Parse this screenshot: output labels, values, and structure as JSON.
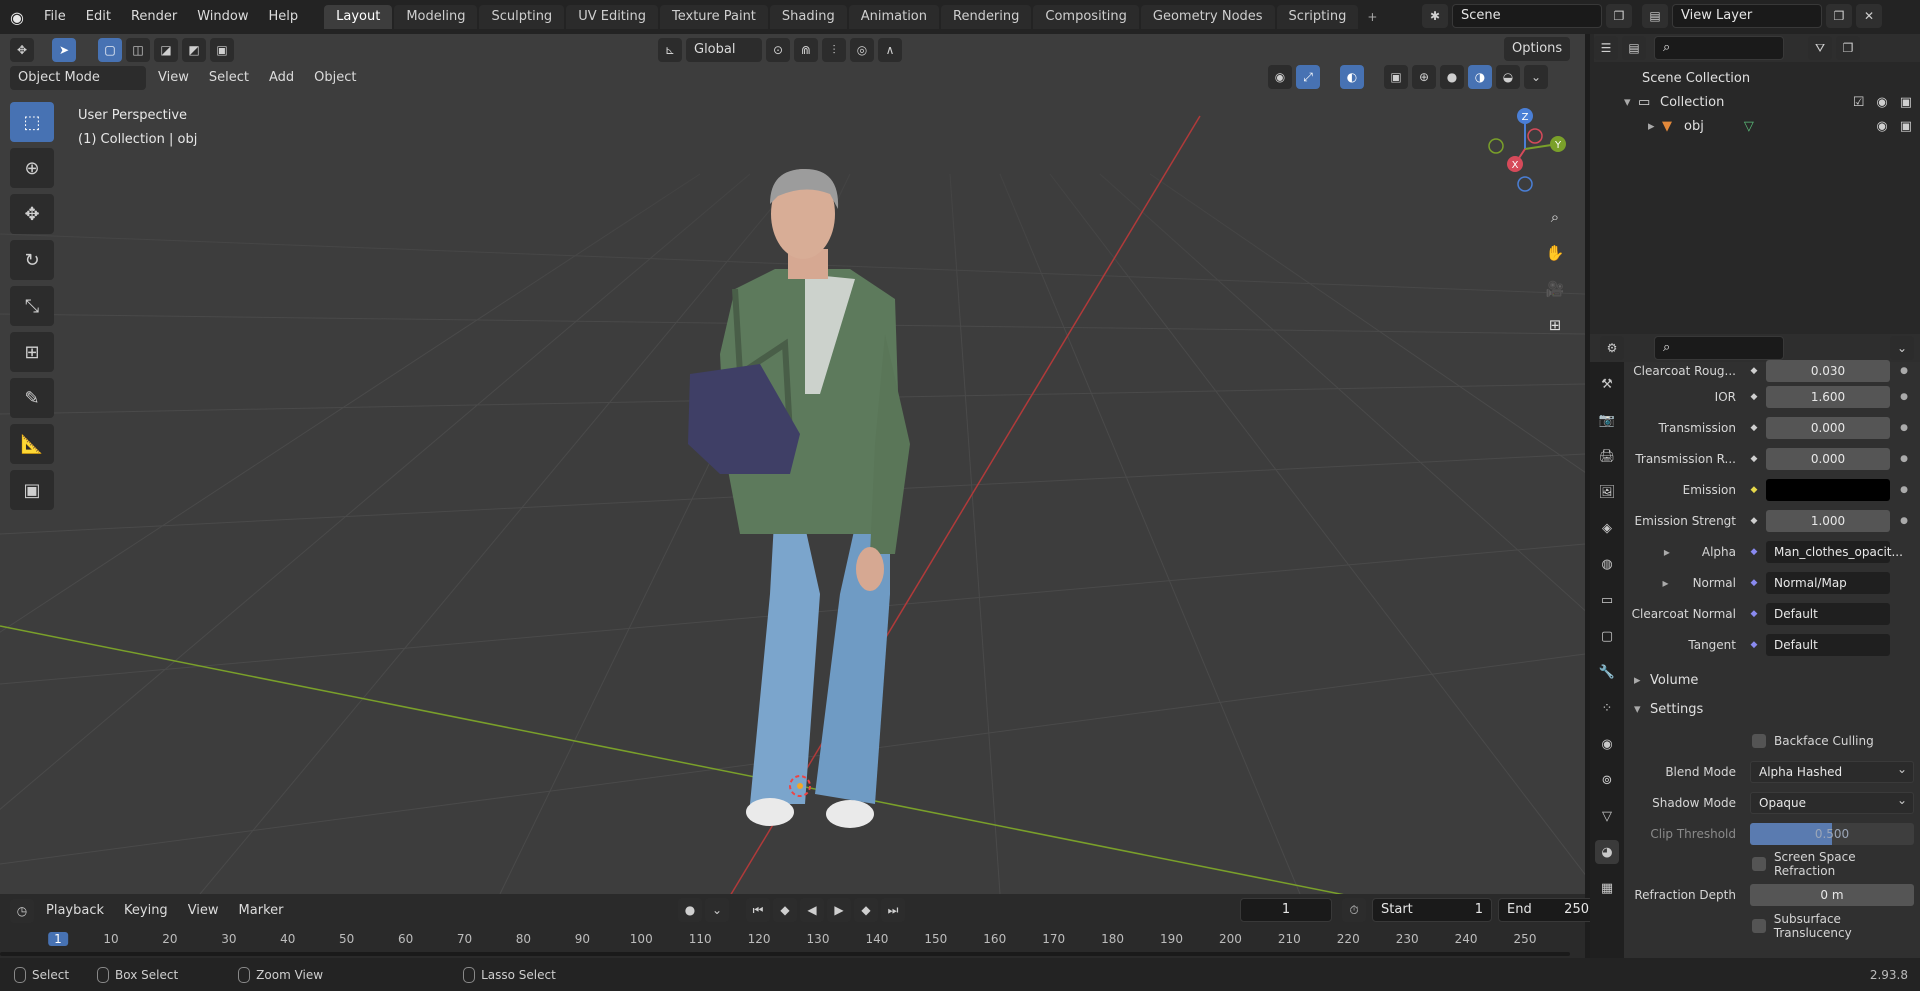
{
  "topbar": {
    "menus": [
      "File",
      "Edit",
      "Render",
      "Window",
      "Help"
    ],
    "workspaces": [
      "Layout",
      "Modeling",
      "Sculpting",
      "UV Editing",
      "Texture Paint",
      "Shading",
      "Animation",
      "Rendering",
      "Compositing",
      "Geometry Nodes",
      "Scripting"
    ],
    "active_workspace": "Layout",
    "scene": "Scene",
    "view_layer": "View Layer"
  },
  "viewport": {
    "orientation": "Global",
    "options": "Options",
    "mode": "Object Mode",
    "menus": [
      "View",
      "Select",
      "Add",
      "Object"
    ],
    "overlay_perspective": "User Perspective",
    "overlay_collection": "(1) Collection | obj",
    "gizmo": {
      "x": "X",
      "y": "Y",
      "z": "Z"
    }
  },
  "timeline": {
    "menus": [
      "Playback",
      "Keying",
      "View",
      "Marker"
    ],
    "current_frame": "1",
    "start_label": "Start",
    "start": "1",
    "end_label": "End",
    "end": "250",
    "ruler_ticks": [
      "1",
      "10",
      "20",
      "30",
      "40",
      "50",
      "60",
      "70",
      "80",
      "90",
      "100",
      "110",
      "120",
      "130",
      "140",
      "150",
      "160",
      "170",
      "180",
      "190",
      "200",
      "210",
      "220",
      "230",
      "240",
      "250"
    ]
  },
  "statusbar": {
    "select": "Select",
    "box_select": "Box Select",
    "zoom_view": "Zoom View",
    "lasso_select": "Lasso Select",
    "version": "2.93.8"
  },
  "outliner": {
    "scene_collection": "Scene Collection",
    "collection": "Collection",
    "object": "obj"
  },
  "properties": {
    "rows": [
      {
        "label": "Clearcoat Roug...",
        "value": "0.030"
      },
      {
        "label": "IOR",
        "value": "1.600"
      },
      {
        "label": "Transmission",
        "value": "0.000"
      },
      {
        "label": "Transmission R...",
        "value": "0.000"
      },
      {
        "label": "Emission",
        "value": ""
      },
      {
        "label": "Emission Strengt",
        "value": "1.000"
      },
      {
        "label": "Alpha",
        "value": "Man_clothes_opacit..."
      },
      {
        "label": "Normal",
        "value": "Normal/Map"
      },
      {
        "label": "Clearcoat Normal",
        "value": "Default"
      },
      {
        "label": "Tangent",
        "value": "Default"
      }
    ],
    "volume_section": "Volume",
    "settings_section": "Settings",
    "backface_culling": "Backface Culling",
    "blend_mode_label": "Blend Mode",
    "blend_mode": "Alpha Hashed",
    "shadow_mode_label": "Shadow Mode",
    "shadow_mode": "Opaque",
    "clip_threshold_label": "Clip Threshold",
    "clip_threshold": "0.500",
    "clip_threshold_fraction": 0.5,
    "ssr": "Screen Space Refraction",
    "refraction_depth_label": "Refraction Depth",
    "refraction_depth": "0 m",
    "subsurface": "Subsurface Translucency"
  }
}
